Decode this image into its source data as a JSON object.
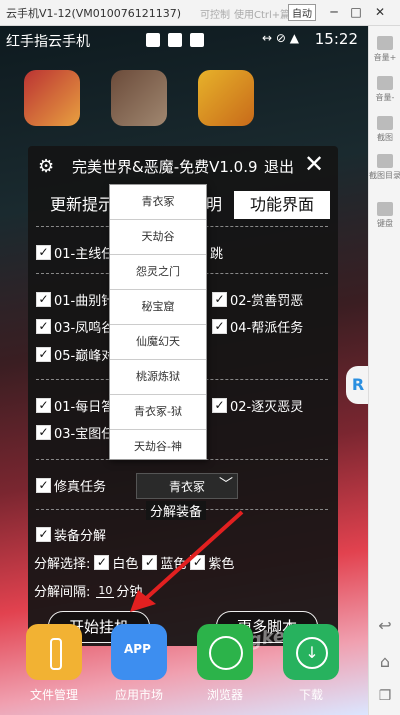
{
  "window": {
    "title": "云手机V1-12(VM010076121137)",
    "control": "可控制",
    "paste_hint": "使用Ctrl+篇",
    "auto": "自动",
    "minimize": "─",
    "restore": "□",
    "close": "✕"
  },
  "statusbar": {
    "carrier": "红手指云手机",
    "time": "15:22",
    "icons": "↔ ⊘ ▲"
  },
  "right_panel": [
    {
      "label": "音量+"
    },
    {
      "label": "音量-"
    },
    {
      "label": "截图"
    },
    {
      "label": "截图目录"
    },
    {
      "label": "键盘"
    }
  ],
  "dialog": {
    "title": "完美世界&恶魔-免费V1.0.9",
    "exit": "退出",
    "close": "✕",
    "tabs": [
      "更新提示",
      "明",
      "功能界面"
    ],
    "options": [
      {
        "label": "01-主线任",
        "checked": true
      },
      {
        "label": "01-曲别针",
        "checked": true
      },
      {
        "label": "02-赏善罚恶",
        "checked": true
      },
      {
        "label": "03-凤鸣谷",
        "checked": true
      },
      {
        "label": "04-帮派任务",
        "checked": true
      },
      {
        "label": "05-巅峰对",
        "checked": true
      },
      {
        "label": "01-每日答",
        "checked": true
      },
      {
        "label": "02-逐灭恶灵",
        "checked": true
      },
      {
        "label": "03-宝图任",
        "checked": true
      }
    ],
    "cultivation": {
      "label": "修真任务",
      "value": "青衣冢"
    },
    "section_decompose": "分解装备",
    "equip_decompose": "装备分解",
    "decompose_select": {
      "label": "分解选择:",
      "white": "白色",
      "blue": "蓝色",
      "purple": "紫色"
    },
    "decompose_interval": {
      "label": "分解间隔:",
      "value": "10",
      "unit": "分钟"
    },
    "start_button": "开始挂机",
    "more_button": "更多脚本"
  },
  "dropdown": [
    "青衣冢",
    "天劫谷",
    "怨灵之门",
    "秘宝窟",
    "仙魔幻天",
    "桃源炼狱",
    "青衣冢-狱",
    "天劫谷-神"
  ],
  "dock": [
    {
      "label": "文件管理"
    },
    {
      "label": "应用市场",
      "icon_text": "APP"
    },
    {
      "label": "浏览器"
    },
    {
      "label": "下载"
    }
  ],
  "watermark": "Lagke.com",
  "colors": {
    "dialog_bg": "#141414",
    "accent_red": "#e2424f",
    "arrow_red": "#e22020"
  }
}
